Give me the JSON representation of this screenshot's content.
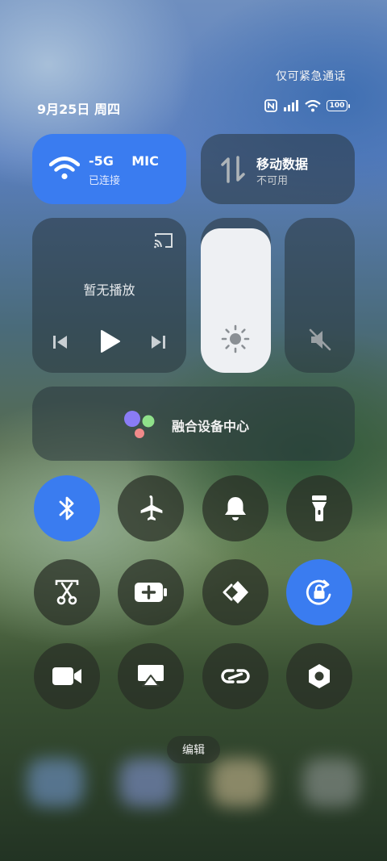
{
  "status_bar": {
    "emergency_text": "仅可紧急通话",
    "date_text": "9月25日 周四",
    "battery": "100",
    "icons": [
      "nfc-icon",
      "signal-icon",
      "wifi-icon",
      "battery-icon"
    ]
  },
  "wifi_tile": {
    "name": "-5G    MIC",
    "status": "已连接",
    "icon": "wifi-icon",
    "active": true
  },
  "mobile_tile": {
    "title": "移动数据",
    "status": "不可用",
    "icon": "data-arrows-icon"
  },
  "media_tile": {
    "title": "暂无播放",
    "icons": [
      "cast-icon",
      "previous-icon",
      "play-icon",
      "next-icon"
    ]
  },
  "brightness": {
    "level": 0.93,
    "icon": "sun-icon"
  },
  "volume": {
    "level": 0,
    "icon": "mute-icon"
  },
  "device_center": {
    "title": "融合设备中心",
    "icon": "assistant-dots-icon"
  },
  "toggles": [
    {
      "name": "bluetooth",
      "icon": "bluetooth-icon",
      "active": true
    },
    {
      "name": "airplane",
      "icon": "airplane-icon",
      "active": false
    },
    {
      "name": "bell",
      "icon": "bell-icon",
      "active": false
    },
    {
      "name": "flashlight",
      "icon": "flashlight-icon",
      "active": false
    },
    {
      "name": "screenshot",
      "icon": "scissors-icon",
      "active": false
    },
    {
      "name": "battery-saver",
      "icon": "battery-plus-icon",
      "active": false
    },
    {
      "name": "nearby-share",
      "icon": "share-diamond-icon",
      "active": false
    },
    {
      "name": "rotation-lock",
      "icon": "rotation-lock-icon",
      "active": true
    },
    {
      "name": "screen-record",
      "icon": "video-icon",
      "active": false
    },
    {
      "name": "screen-cast",
      "icon": "airplay-icon",
      "active": false
    },
    {
      "name": "link",
      "icon": "link-icon",
      "active": false
    },
    {
      "name": "settings",
      "icon": "hex-nut-icon",
      "active": false
    }
  ],
  "edit_label": "编辑",
  "colors": {
    "accent": "#3a7cf0",
    "tile": "#2a343c",
    "brightness_fill": "#eef0f3"
  }
}
